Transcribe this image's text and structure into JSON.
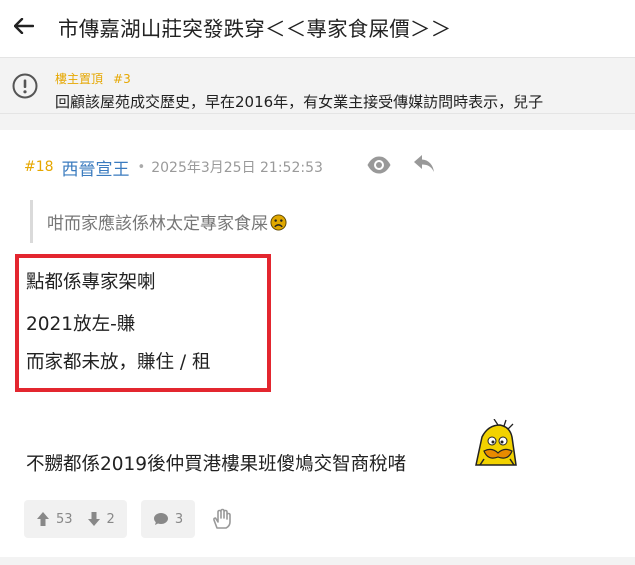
{
  "header": {
    "title": "市傳嘉湖山莊突發跌穿＜＜專家食屎價＞＞"
  },
  "pinned": {
    "label": "樓主置頂",
    "floor": "#3",
    "text": "回顧該屋苑成交歷史，早在2016年，有女業主接受傳媒訪問時表示，兒子"
  },
  "post": {
    "floor": "#18",
    "username": "西晉宣王",
    "separator": "•",
    "timestamp": "2025年3月25日 21:52:53",
    "quote": "咁而家應該係林太定專家食屎",
    "highlighted_lines": [
      "點都係專家架喇",
      "2021放左-賺",
      "而家都未放，賺住 / 租"
    ],
    "closing_text": "不嬲都係2019後仲買港樓果班傻鳩交智商稅啫",
    "upvotes": "53",
    "downvotes": "2",
    "comments": "3"
  },
  "colors": {
    "floor": "#e6a700",
    "username": "#3a7bbf",
    "highlight_border": "#e3262f",
    "meta": "#9a9a9a"
  },
  "icons": [
    "back-arrow-icon",
    "info-icon",
    "eye-icon",
    "reply-icon",
    "sad-face-icon",
    "pencil-emoji-icon",
    "thumb-up-icon",
    "thumb-down-icon",
    "comment-icon",
    "hand-icon"
  ]
}
